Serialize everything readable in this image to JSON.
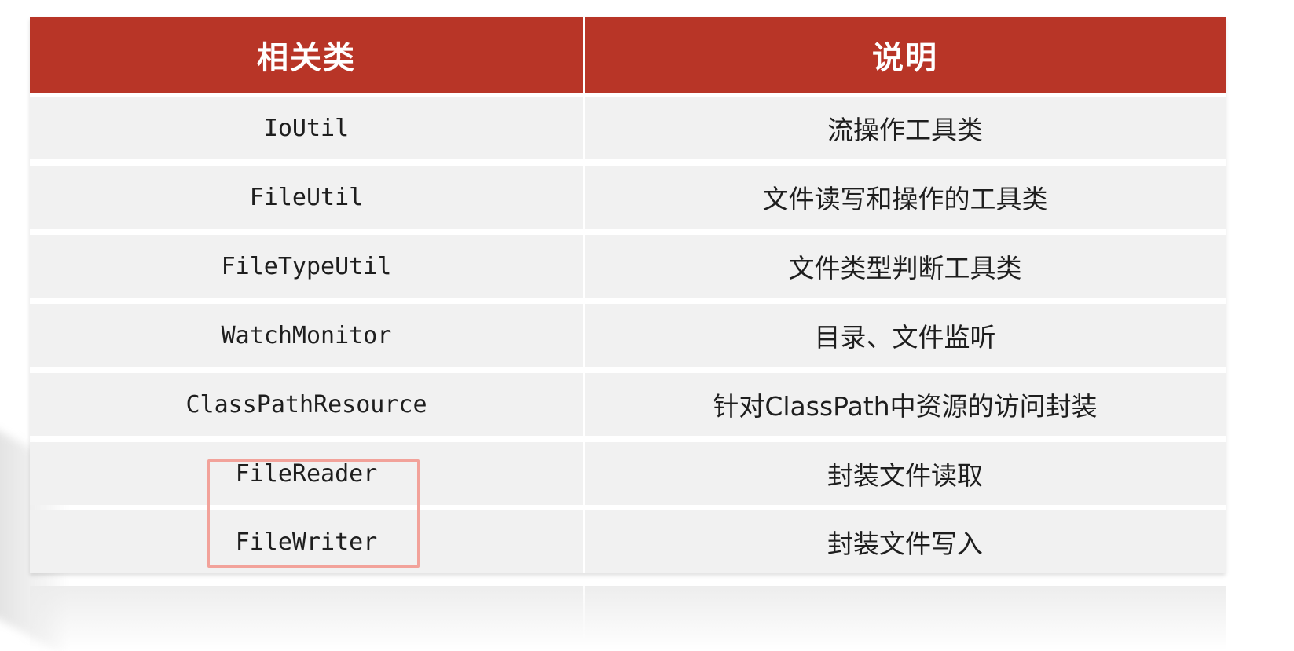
{
  "table": {
    "headers": [
      "相关类",
      "说明"
    ],
    "rows": [
      [
        "IoUtil",
        "流操作工具类"
      ],
      [
        "FileUtil",
        "文件读写和操作的工具类"
      ],
      [
        "FileTypeUtil",
        "文件类型判断工具类"
      ],
      [
        "WatchMonitor",
        "目录、文件监听"
      ],
      [
        "ClassPathResource",
        "针对ClassPath中资源的访问封装"
      ],
      [
        "FileReader",
        "封装文件读取"
      ],
      [
        "FileWriter",
        "封装文件写入"
      ]
    ]
  },
  "colors": {
    "header_background": "#b83527",
    "row_background": "#f1f1f1",
    "highlight_border": "#f2a29a"
  }
}
